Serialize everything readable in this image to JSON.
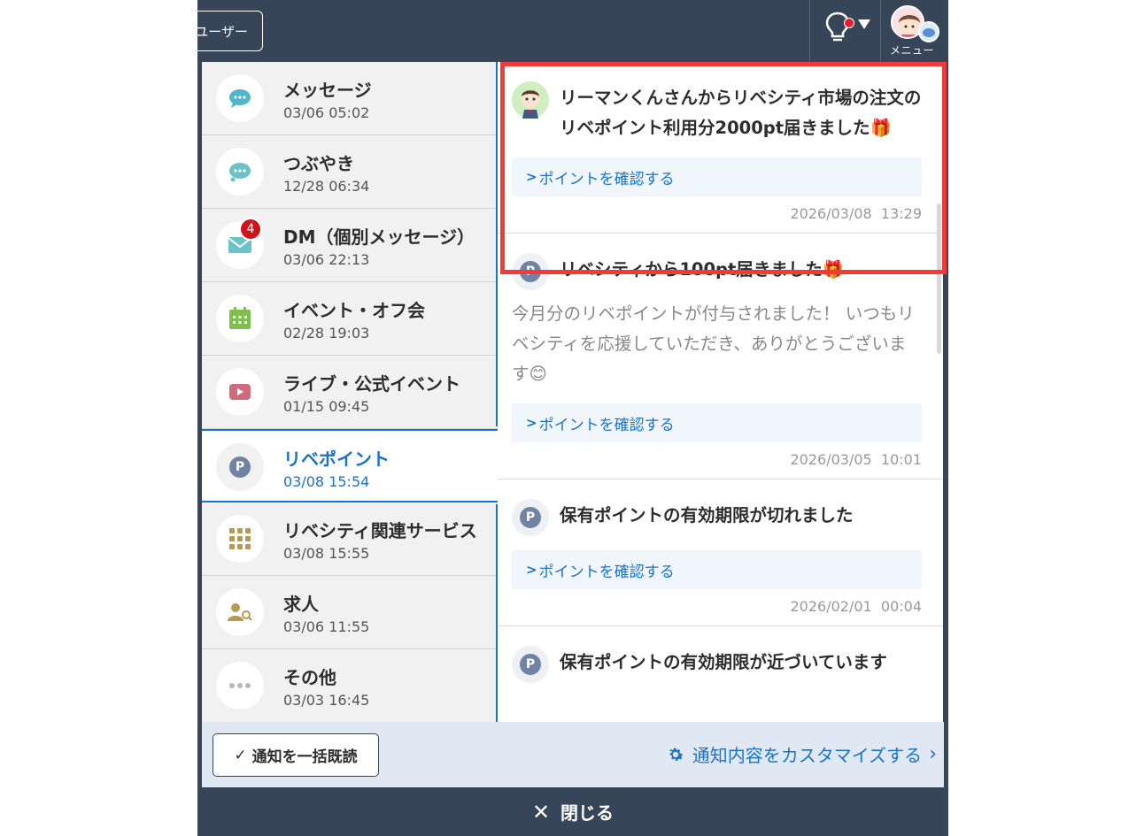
{
  "header": {
    "user_button_label": "ユーザー",
    "menu_label": "メニュー"
  },
  "sidebar": {
    "items": [
      {
        "icon": "message-bubble-icon",
        "title": "メッセージ",
        "date": "03/06 05:02",
        "color": "#4fb7c8"
      },
      {
        "icon": "murmur-bubble-icon",
        "title": "つぶやき",
        "date": "12/28 06:34",
        "color": "#6cc3c7"
      },
      {
        "icon": "mail-icon",
        "title": "DM（個別メッセージ）",
        "date": "03/06 22:13",
        "color": "#6cc3c7",
        "badge": "4"
      },
      {
        "icon": "calendar-icon",
        "title": "イベント・オフ会",
        "date": "02/28 19:03",
        "color": "#7fbf4d"
      },
      {
        "icon": "video-play-icon",
        "title": "ライブ・公式イベント",
        "date": "01/15 09:45",
        "color": "#d06a7e"
      },
      {
        "icon": "point-icon",
        "title": "リベポイント",
        "date": "03/08 15:54",
        "color": "#7183a3",
        "active": true
      },
      {
        "icon": "grid-icon",
        "title": "リベシティ関連サービス",
        "date": "03/08 15:55",
        "color": "#b49a55"
      },
      {
        "icon": "job-search-icon",
        "title": "求人",
        "date": "03/06 11:55",
        "color": "#b49a55"
      },
      {
        "icon": "more-dots-icon",
        "title": "その他",
        "date": "03/03 16:45",
        "color": "#b7b7b7"
      }
    ]
  },
  "notifications": [
    {
      "type": "avatar",
      "title": "リーマンくんさんからリベシティ市場の注文のリベポイント利用分2000pt届きました🎁",
      "body": "",
      "link": "ポイントを確認する",
      "date": "2026/03/08",
      "time": "13:29"
    },
    {
      "type": "point",
      "title": "リベシティから100pt届きました🎁",
      "body": "今月分のリベポイントが付与されました！ いつもリベシティを応援していただき、ありがとうございます😊",
      "link": "ポイントを確認する",
      "date": "2026/03/05",
      "time": "10:01"
    },
    {
      "type": "point",
      "title": "保有ポイントの有効期限が切れました",
      "body": "",
      "link": "ポイントを確認する",
      "date": "2026/02/01",
      "time": "00:04"
    },
    {
      "type": "point",
      "title": "保有ポイントの有効期限が近づいています",
      "body": "",
      "link": "",
      "date": "",
      "time": ""
    }
  ],
  "footer": {
    "mark_all_read": "通知を一括既読",
    "customize": "通知内容をカスタマイズする",
    "close": "閉じる"
  },
  "colors": {
    "header_bg": "#374559",
    "accent": "#1a73c9",
    "badge": "#d0121b",
    "highlight": "#f23a3a"
  }
}
